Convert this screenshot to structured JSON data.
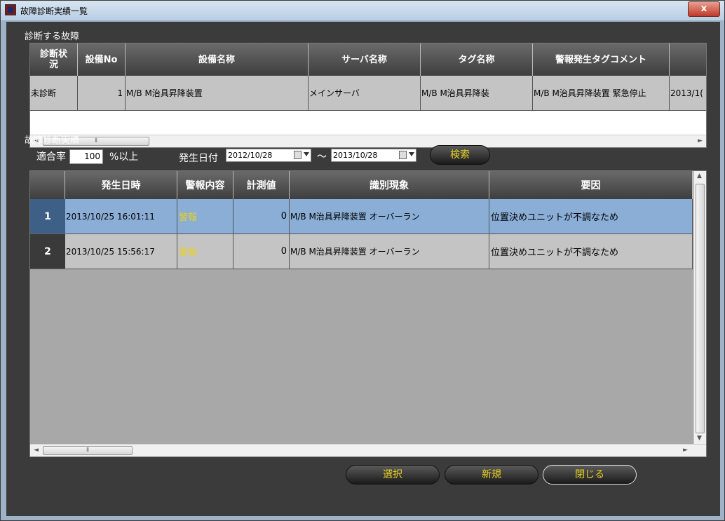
{
  "window": {
    "title": "故障診断実績一覧",
    "close_label": "x"
  },
  "section1": {
    "label": "診断する故障",
    "columns": [
      "診断状況",
      "設備No",
      "設備名称",
      "サーバ名称",
      "タグ名称",
      "警報発生タグコメント",
      ""
    ],
    "col0_line1": "診断状",
    "col0_line2": "況",
    "row": [
      "未診断",
      "1",
      "M/B M治具昇降装置",
      "メインサーバ",
      "M/B M治具昇降装",
      "M/B M治具昇降装置 緊急停止",
      "2013/1("
    ]
  },
  "section2": {
    "label": "故障診断実績",
    "match_rate_label": "適合率",
    "match_rate_value": "100",
    "match_rate_suffix": "%以上",
    "date_label": "発生日付",
    "date_from": "2012/10/28",
    "date_sep": "～",
    "date_to": "2013/10/28",
    "search_label": "検索",
    "columns": [
      "",
      "発生日時",
      "警報内容",
      "計測値",
      "識別現象",
      "要因"
    ],
    "rows": [
      {
        "num": "1",
        "datetime": "2013/10/25 16:01:11",
        "alarm": "警報",
        "value": "0",
        "phenomenon": "M/B M治具昇降装置 オーバーラン",
        "cause": "位置決めユニットが不調なため"
      },
      {
        "num": "2",
        "datetime": "2013/10/25 15:56:17",
        "alarm": "警報",
        "value": "0",
        "phenomenon": "M/B M治具昇降装置 オーバーラン",
        "cause": "位置決めユニットが不調なため"
      }
    ]
  },
  "footer": {
    "select_label": "選択",
    "new_label": "新規",
    "close_label": "閉じる"
  },
  "colors": {
    "alarm_text": "#e8d020",
    "selected_row": "#8aaed6",
    "button_text": "#e8d020"
  }
}
